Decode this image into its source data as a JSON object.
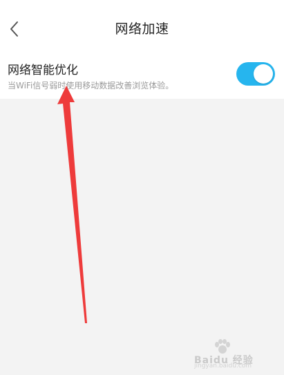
{
  "header": {
    "title": "网络加速",
    "back_icon": "chevron-left-icon"
  },
  "setting": {
    "title": "网络智能优化",
    "description": "当WiFi信号弱时使用移动数据改善浏览体验。",
    "toggle_on": true,
    "accent_color": "#26b5ee"
  },
  "annotation": {
    "arrow_color": "#ee3b3b"
  },
  "watermark": {
    "text": "Baidu 经验",
    "domain": "jingyan.baidu.com"
  }
}
